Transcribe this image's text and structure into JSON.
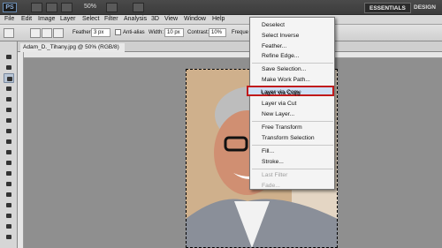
{
  "app": {
    "logo": "PS",
    "zoom": "50%",
    "workspaces": [
      "ESSENTIALS",
      "DESIGN"
    ]
  },
  "menubar": [
    "File",
    "Edit",
    "Image",
    "Layer",
    "Select",
    "Filter",
    "Analysis",
    "3D",
    "View",
    "Window",
    "Help"
  ],
  "options": {
    "feather_label": "Feather:",
    "feather_value": "3 px",
    "antialias_label": "Anti-alias",
    "width_label": "Width:",
    "width_value": "10 px",
    "contrast_label": "Contrast:",
    "contrast_value": "10%",
    "frequency_label": "Freque"
  },
  "document": {
    "tab_title": "Adam_D._Tihany.jpg @ 50% (RGB/8)"
  },
  "context_menu": {
    "items": [
      {
        "label": "Deselect",
        "enabled": true
      },
      {
        "label": "Select Inverse",
        "enabled": true
      },
      {
        "label": "Feather...",
        "enabled": true
      },
      {
        "label": "Refine Edge...",
        "enabled": true
      },
      {
        "label": "Save Selection...",
        "enabled": true
      },
      {
        "label": "Make Work Path...",
        "enabled": true
      },
      {
        "label": "Layer via Copy",
        "enabled": true,
        "highlighted": true
      },
      {
        "label": "Layer via Cut",
        "enabled": true
      },
      {
        "label": "New Layer...",
        "enabled": true
      },
      {
        "label": "Free Transform",
        "enabled": true
      },
      {
        "label": "Transform Selection",
        "enabled": true
      },
      {
        "label": "Fill...",
        "enabled": true
      },
      {
        "label": "Stroke...",
        "enabled": true
      },
      {
        "label": "Last Filter",
        "enabled": false
      },
      {
        "label": "Fade...",
        "enabled": false
      }
    ]
  },
  "colors": {
    "highlight_border": "#c01a1a",
    "menu_bg": "#f4f4f4",
    "canvas_bg": "#8f8f8f"
  }
}
